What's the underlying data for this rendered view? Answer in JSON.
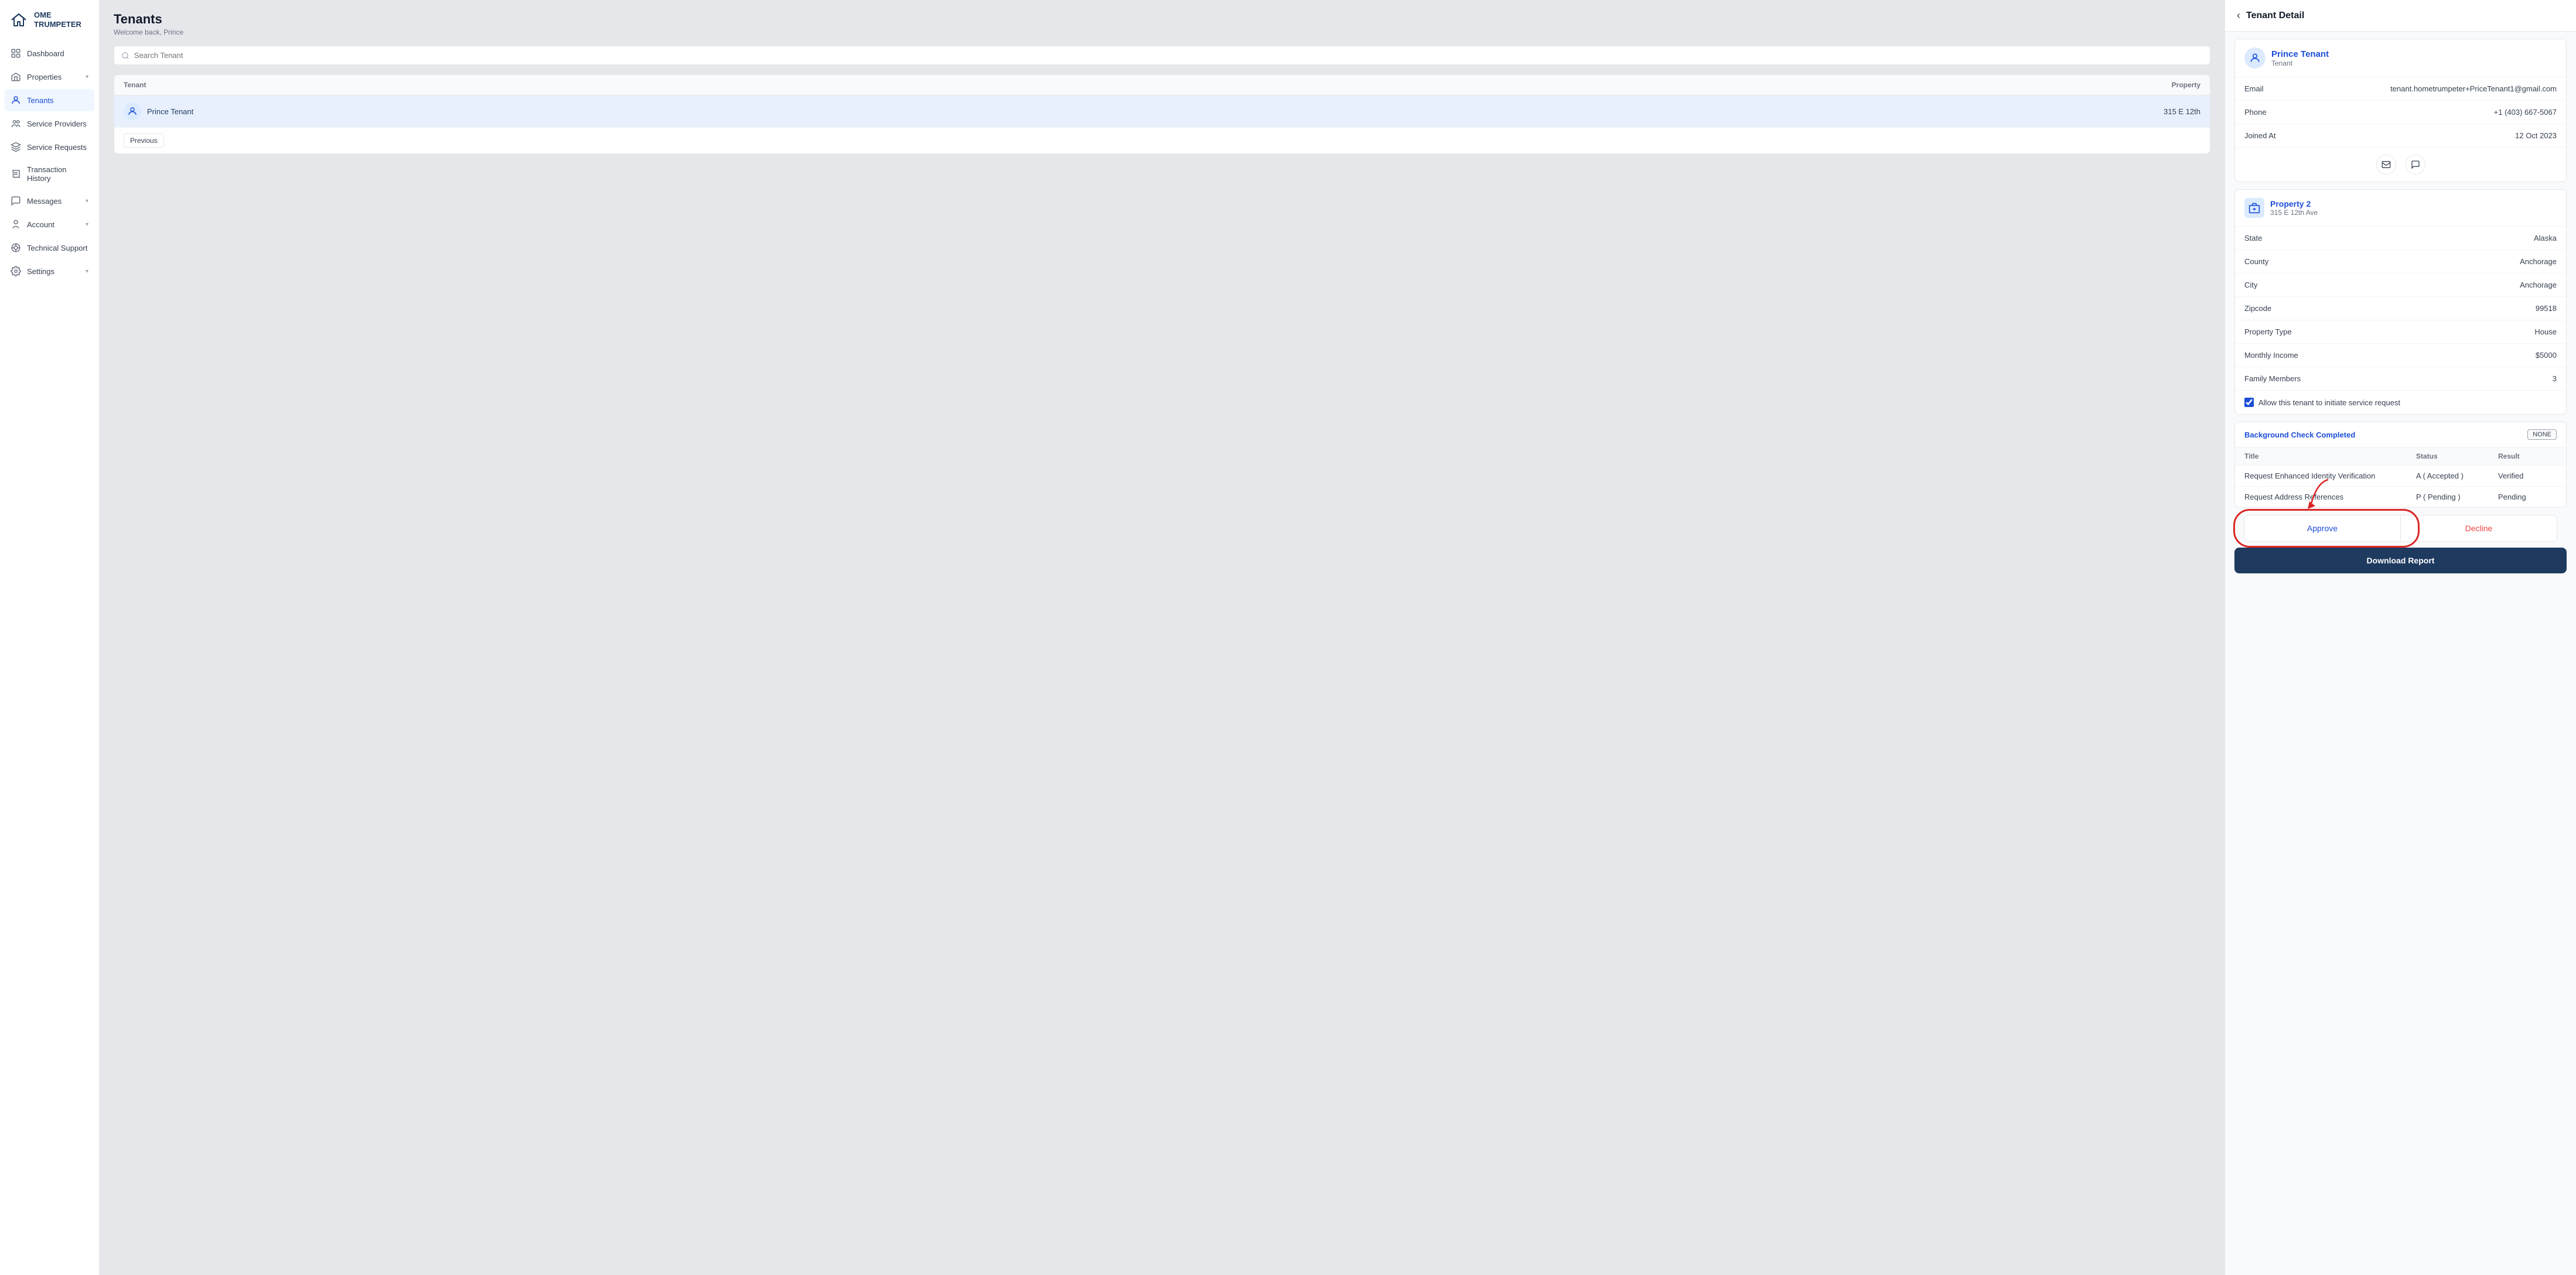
{
  "app": {
    "logo_text": "OME TRUMPETER"
  },
  "sidebar": {
    "items": [
      {
        "id": "dashboard",
        "label": "Dashboard",
        "icon": "grid-icon"
      },
      {
        "id": "properties",
        "label": "Properties",
        "icon": "home-icon",
        "has_chevron": true
      },
      {
        "id": "tenants",
        "label": "Tenants",
        "icon": "user-icon",
        "active": true
      },
      {
        "id": "service-providers",
        "label": "Service Providers",
        "icon": "users-icon"
      },
      {
        "id": "service-requests",
        "label": "Service Requests",
        "icon": "layers-icon"
      },
      {
        "id": "transaction-history",
        "label": "Transaction History",
        "icon": "receipt-icon"
      },
      {
        "id": "messages",
        "label": "Messages",
        "icon": "message-icon",
        "has_chevron": true
      },
      {
        "id": "account",
        "label": "Account",
        "icon": "person-icon",
        "has_chevron": true
      },
      {
        "id": "technical-support",
        "label": "Technical Support",
        "icon": "support-icon"
      },
      {
        "id": "settings",
        "label": "Settings",
        "icon": "gear-icon",
        "has_chevron": true
      }
    ]
  },
  "tenants_list": {
    "page_title": "Tenants",
    "subtitle": "Welcome back, Prince",
    "search_placeholder": "Search Tenant",
    "table_headers": {
      "tenant": "Tenant",
      "property": "Property"
    },
    "rows": [
      {
        "name": "Prince Tenant",
        "property": "315 E 12th"
      }
    ],
    "footer": {
      "prev_label": "Previous"
    }
  },
  "tenant_detail": {
    "header_title": "Tenant Detail",
    "back_label": "‹",
    "tenant": {
      "name": "Prince Tenant",
      "role": "Tenant",
      "email_label": "Email",
      "email_value": "tenant.hometrumpeter+PriceTenant1@gmail.com",
      "phone_label": "Phone",
      "phone_value": "+1 (403) 667-5067",
      "joined_label": "Joined At",
      "joined_value": "12 Oct 2023"
    },
    "property": {
      "name": "Property 2",
      "address": "315 E 12th Ave",
      "state_label": "State",
      "state_value": "Alaska",
      "county_label": "County",
      "county_value": "Anchorage",
      "city_label": "City",
      "city_value": "Anchorage",
      "zipcode_label": "Zipcode",
      "zipcode_value": "99518",
      "property_type_label": "Property Type",
      "property_type_value": "House",
      "monthly_income_label": "Monthly Income",
      "monthly_income_value": "$5000",
      "family_members_label": "Family Members",
      "family_members_value": "3",
      "service_request_label": "Allow this tenant to initiate service request"
    },
    "background_check": {
      "title": "Background Check Completed",
      "badge": "NONE",
      "col_title": "Title",
      "col_status": "Status",
      "col_result": "Result",
      "rows": [
        {
          "title": "Request Enhanced Identity Verification",
          "status": "A ( Accepted )",
          "result": "Verified"
        },
        {
          "title": "Request Address References",
          "status": "P ( Pending )",
          "result": "Pending"
        }
      ]
    },
    "actions": {
      "approve_label": "Approve",
      "decline_label": "Decline",
      "download_label": "Download Report"
    }
  }
}
